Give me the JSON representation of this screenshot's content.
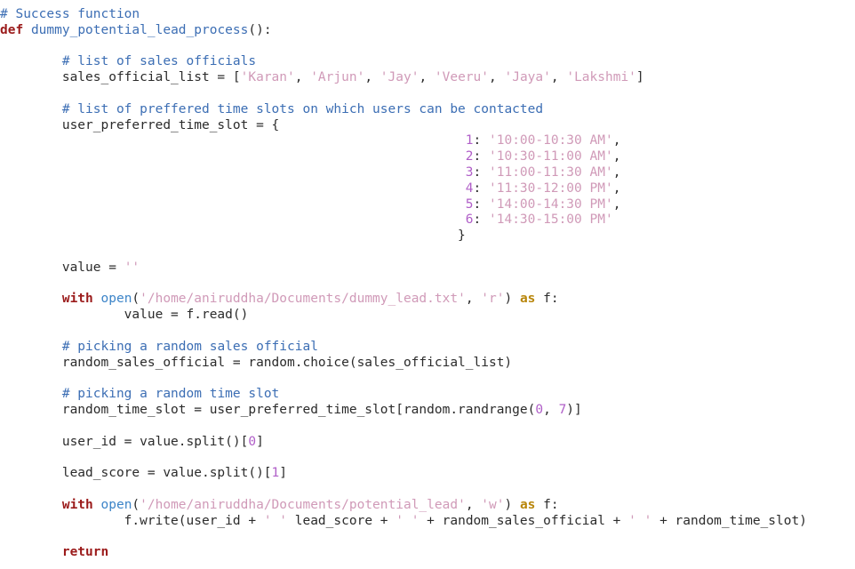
{
  "editor": {
    "language": "python",
    "background_color": "#ffffff",
    "default_text_color": "#2b2b2b",
    "theme_colors": {
      "comment": "#3c6eb4",
      "keyword": "#9b1b1b",
      "keyword_alt": "#b8860b",
      "function_name": "#3c6eb4",
      "builtin": "#3c84c8",
      "string": "#d09ab8",
      "number": "#b05fc8"
    }
  },
  "code": {
    "lines": [
      {
        "id": 1,
        "tokens": [
          {
            "t": "# Success function",
            "c": "cmt"
          }
        ]
      },
      {
        "id": 2,
        "tokens": [
          {
            "t": "def",
            "c": "kw"
          },
          {
            "t": " ",
            "c": "txt"
          },
          {
            "t": "dummy_potential_lead_process",
            "c": "fn"
          },
          {
            "t": "():",
            "c": "punc"
          }
        ]
      },
      {
        "id": 3,
        "tokens": []
      },
      {
        "id": 4,
        "tokens": [
          {
            "t": "        ",
            "c": "txt"
          },
          {
            "t": "# list of sales officials",
            "c": "cmt"
          }
        ]
      },
      {
        "id": 5,
        "tokens": [
          {
            "t": "        sales_official_list = [",
            "c": "txt"
          },
          {
            "t": "'Karan'",
            "c": "str"
          },
          {
            "t": ", ",
            "c": "txt"
          },
          {
            "t": "'Arjun'",
            "c": "str"
          },
          {
            "t": ", ",
            "c": "txt"
          },
          {
            "t": "'Jay'",
            "c": "str"
          },
          {
            "t": ", ",
            "c": "txt"
          },
          {
            "t": "'Veeru'",
            "c": "str"
          },
          {
            "t": ", ",
            "c": "txt"
          },
          {
            "t": "'Jaya'",
            "c": "str"
          },
          {
            "t": ", ",
            "c": "txt"
          },
          {
            "t": "'Lakshmi'",
            "c": "str"
          },
          {
            "t": "]",
            "c": "txt"
          }
        ]
      },
      {
        "id": 6,
        "tokens": []
      },
      {
        "id": 7,
        "tokens": [
          {
            "t": "        ",
            "c": "txt"
          },
          {
            "t": "# list of preffered time slots on which users can be contacted",
            "c": "cmt"
          }
        ]
      },
      {
        "id": 8,
        "tokens": [
          {
            "t": "        user_preferred_time_slot = {",
            "c": "txt"
          }
        ]
      },
      {
        "id": 9,
        "tokens": [
          {
            "t": "                                                            ",
            "c": "txt"
          },
          {
            "t": "1",
            "c": "num"
          },
          {
            "t": ": ",
            "c": "txt"
          },
          {
            "t": "'10:00-10:30 AM'",
            "c": "str"
          },
          {
            "t": ",",
            "c": "txt"
          }
        ]
      },
      {
        "id": 10,
        "tokens": [
          {
            "t": "                                                            ",
            "c": "txt"
          },
          {
            "t": "2",
            "c": "num"
          },
          {
            "t": ": ",
            "c": "txt"
          },
          {
            "t": "'10:30-11:00 AM'",
            "c": "str"
          },
          {
            "t": ",",
            "c": "txt"
          }
        ]
      },
      {
        "id": 11,
        "tokens": [
          {
            "t": "                                                            ",
            "c": "txt"
          },
          {
            "t": "3",
            "c": "num"
          },
          {
            "t": ": ",
            "c": "txt"
          },
          {
            "t": "'11:00-11:30 AM'",
            "c": "str"
          },
          {
            "t": ",",
            "c": "txt"
          }
        ]
      },
      {
        "id": 12,
        "tokens": [
          {
            "t": "                                                            ",
            "c": "txt"
          },
          {
            "t": "4",
            "c": "num"
          },
          {
            "t": ": ",
            "c": "txt"
          },
          {
            "t": "'11:30-12:00 PM'",
            "c": "str"
          },
          {
            "t": ",",
            "c": "txt"
          }
        ]
      },
      {
        "id": 13,
        "tokens": [
          {
            "t": "                                                            ",
            "c": "txt"
          },
          {
            "t": "5",
            "c": "num"
          },
          {
            "t": ": ",
            "c": "txt"
          },
          {
            "t": "'14:00-14:30 PM'",
            "c": "str"
          },
          {
            "t": ",",
            "c": "txt"
          }
        ]
      },
      {
        "id": 14,
        "tokens": [
          {
            "t": "                                                            ",
            "c": "txt"
          },
          {
            "t": "6",
            "c": "num"
          },
          {
            "t": ": ",
            "c": "txt"
          },
          {
            "t": "'14:30-15:00 PM'",
            "c": "str"
          }
        ]
      },
      {
        "id": 15,
        "tokens": [
          {
            "t": "                                                           }",
            "c": "txt"
          }
        ]
      },
      {
        "id": 16,
        "tokens": []
      },
      {
        "id": 17,
        "tokens": [
          {
            "t": "        value = ",
            "c": "txt"
          },
          {
            "t": "''",
            "c": "str"
          }
        ]
      },
      {
        "id": 18,
        "tokens": []
      },
      {
        "id": 19,
        "tokens": [
          {
            "t": "        ",
            "c": "txt"
          },
          {
            "t": "with",
            "c": "kw"
          },
          {
            "t": " ",
            "c": "txt"
          },
          {
            "t": "open",
            "c": "bi"
          },
          {
            "t": "(",
            "c": "txt"
          },
          {
            "t": "'/home/aniruddha/Documents/dummy_lead.txt'",
            "c": "str"
          },
          {
            "t": ", ",
            "c": "txt"
          },
          {
            "t": "'r'",
            "c": "str"
          },
          {
            "t": ") ",
            "c": "txt"
          },
          {
            "t": "as",
            "c": "kw2"
          },
          {
            "t": " f:",
            "c": "txt"
          }
        ]
      },
      {
        "id": 20,
        "tokens": [
          {
            "t": "                value = f.read()",
            "c": "txt"
          }
        ]
      },
      {
        "id": 21,
        "tokens": []
      },
      {
        "id": 22,
        "tokens": [
          {
            "t": "        ",
            "c": "txt"
          },
          {
            "t": "# picking a random sales official",
            "c": "cmt"
          }
        ]
      },
      {
        "id": 23,
        "tokens": [
          {
            "t": "        random_sales_official = random.choice(sales_official_list)",
            "c": "txt"
          }
        ]
      },
      {
        "id": 24,
        "tokens": []
      },
      {
        "id": 25,
        "tokens": [
          {
            "t": "        ",
            "c": "txt"
          },
          {
            "t": "# picking a random time slot",
            "c": "cmt"
          }
        ]
      },
      {
        "id": 26,
        "tokens": [
          {
            "t": "        random_time_slot = user_preferred_time_slot[random.randrange(",
            "c": "txt"
          },
          {
            "t": "0",
            "c": "num"
          },
          {
            "t": ", ",
            "c": "txt"
          },
          {
            "t": "7",
            "c": "num"
          },
          {
            "t": ")]",
            "c": "txt"
          }
        ]
      },
      {
        "id": 27,
        "tokens": []
      },
      {
        "id": 28,
        "tokens": [
          {
            "t": "        user_id = value.split()[",
            "c": "txt"
          },
          {
            "t": "0",
            "c": "num"
          },
          {
            "t": "]",
            "c": "txt"
          }
        ]
      },
      {
        "id": 29,
        "tokens": []
      },
      {
        "id": 30,
        "tokens": [
          {
            "t": "        lead_score = value.split()[",
            "c": "txt"
          },
          {
            "t": "1",
            "c": "num"
          },
          {
            "t": "]",
            "c": "txt"
          }
        ]
      },
      {
        "id": 31,
        "tokens": []
      },
      {
        "id": 32,
        "tokens": [
          {
            "t": "        ",
            "c": "txt"
          },
          {
            "t": "with",
            "c": "kw"
          },
          {
            "t": " ",
            "c": "txt"
          },
          {
            "t": "open",
            "c": "bi"
          },
          {
            "t": "(",
            "c": "txt"
          },
          {
            "t": "'/home/aniruddha/Documents/potential_lead'",
            "c": "str"
          },
          {
            "t": ", ",
            "c": "txt"
          },
          {
            "t": "'w'",
            "c": "str"
          },
          {
            "t": ") ",
            "c": "txt"
          },
          {
            "t": "as",
            "c": "kw2"
          },
          {
            "t": " f:",
            "c": "txt"
          }
        ]
      },
      {
        "id": 33,
        "tokens": [
          {
            "t": "                f.write(user_id + ",
            "c": "txt"
          },
          {
            "t": "' '",
            "c": "str"
          },
          {
            "t": " lead_score + ",
            "c": "txt"
          },
          {
            "t": "' '",
            "c": "str"
          },
          {
            "t": " + random_sales_official + ",
            "c": "txt"
          },
          {
            "t": "' '",
            "c": "str"
          },
          {
            "t": " + random_time_slot)",
            "c": "txt"
          }
        ]
      },
      {
        "id": 34,
        "tokens": []
      },
      {
        "id": 35,
        "tokens": [
          {
            "t": "        ",
            "c": "txt"
          },
          {
            "t": "return",
            "c": "kw"
          }
        ]
      }
    ]
  }
}
